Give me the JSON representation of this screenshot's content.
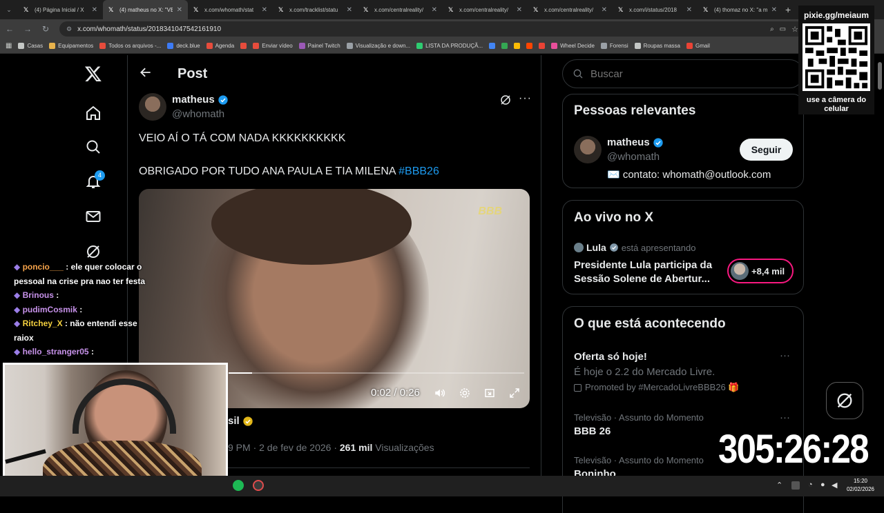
{
  "browser": {
    "tabs": [
      {
        "title": "(4) Página Inicial / X",
        "active": false
      },
      {
        "title": "(4) matheus no X: \"VE",
        "active": true
      },
      {
        "title": "x.com/whomath/stat",
        "active": false
      },
      {
        "title": "x.com/tracklist/statu",
        "active": false
      },
      {
        "title": "x.com/centralreality/",
        "active": false
      },
      {
        "title": "x.com/centralreality/",
        "active": false
      },
      {
        "title": "x.com/centralreality/",
        "active": false
      },
      {
        "title": "x.com/i/status/2018",
        "active": false
      },
      {
        "title": "(4) thomaz no X: \"a m",
        "active": false
      }
    ],
    "url": "x.com/whomath/status/2018341047542161910",
    "bookmarks": [
      "Casas",
      "Equipamentos",
      "Todos os arquivos -...",
      "deck.blue",
      "Agenda",
      "",
      "Enviar vídeo",
      "Painel Twitch",
      "Visualização e down...",
      "LISTA DA PRODUÇÃ...",
      "",
      "",
      "",
      "",
      "",
      "Wheel Decide",
      "Forensi",
      "Roupas massa",
      "Gmail"
    ]
  },
  "nav": {
    "notif_count": "4"
  },
  "post": {
    "header_title": "Post",
    "author_name": "matheus",
    "author_handle": "@whomath",
    "text_line1": "VEIO AÍ O TÁ COM NADA KKKKKKKKKK",
    "text_line2_prefix": "OBRIGADO POR TUDO ANA PAULA E TIA MILENA",
    "hashtag": "#BBB26",
    "video_time": "0:02 / 0:26",
    "video_progress": 0.08,
    "video_watermark": "BBB",
    "source_partial": "sil",
    "meta_time": "9 PM · 2 de fev de 2026 · ",
    "meta_views_count": "261 mil",
    "meta_views_label": "Visualizações"
  },
  "search": {
    "placeholder": "Buscar"
  },
  "relevant": {
    "title": "Pessoas relevantes",
    "name": "matheus",
    "handle": "@whomath",
    "bio": "✉️ contato: whomath@outlook.com",
    "follow_label": "Seguir"
  },
  "live": {
    "title": "Ao vivo no X",
    "host": "Lula",
    "host_suffix": "está apresentando",
    "headline": "Presidente Lula participa da Sessão Solene de Abertur...",
    "listeners": "+8,4 mil"
  },
  "trends": {
    "title": "O que está acontecendo",
    "items": [
      {
        "title": "Oferta só hoje!",
        "subtitle": "É hoje o 2.2 do Mercado Livre.",
        "promo": "Promoted by #MercadoLivreBBB26 🎁"
      },
      {
        "context": "Televisão · Assunto do Momento",
        "title": "BBB 26"
      },
      {
        "context": "Televisão · Assunto do Momento",
        "title": "Boninho"
      }
    ]
  },
  "overlay": {
    "qr_handle": "pixie.gg/meiaum",
    "qr_caption_1": "use a câmera do",
    "qr_caption_2": "celular",
    "timer": "305:26:28"
  },
  "chat": [
    {
      "user": "poncio___",
      "msg": "ele quer colocar o"
    },
    {
      "user": "",
      "msg": "pessoal na crise pra nao ter festa"
    },
    {
      "user": "Brinous",
      "msg": ""
    },
    {
      "user": "pudimCosmik",
      "msg": ""
    },
    {
      "user": "Ritchey_X",
      "msg": "não entendi esse"
    },
    {
      "user": "",
      "msg": "raiox"
    },
    {
      "user": "hello_stranger05",
      "msg": ""
    }
  ],
  "taskbar": {
    "time": "15:20",
    "date": "02/02/2026"
  },
  "colors": {
    "accent": "#1d9bf0",
    "bg": "#000000",
    "border": "#2f3336",
    "muted": "#71767b",
    "live_pink": "#f91880",
    "timer": "#ffffff"
  }
}
